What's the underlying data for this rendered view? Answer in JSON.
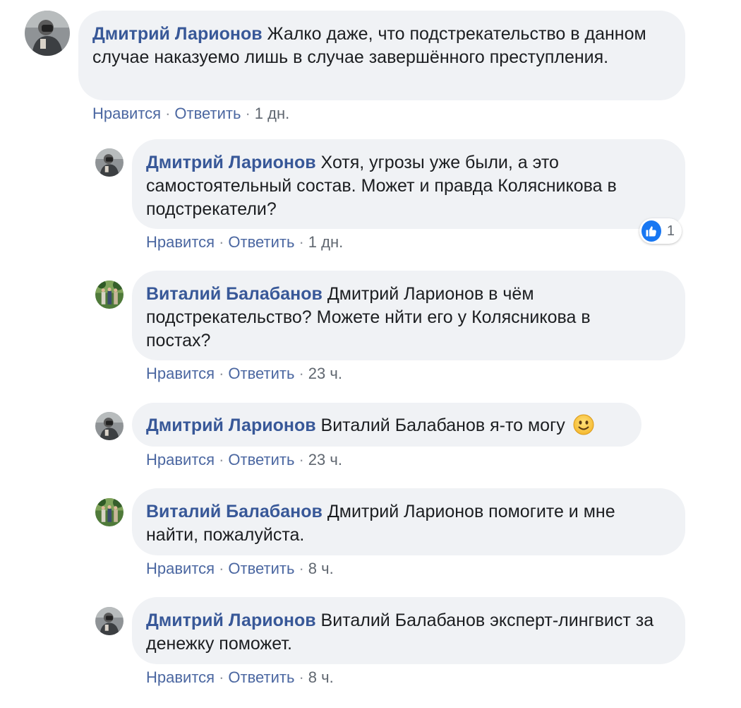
{
  "comments": [
    {
      "author": "Дмитрий Ларионов",
      "text": "Жалко даже, что подстрекательство в данном случае наказуемо лишь в случае завершённого преступления.",
      "like_label": "Нравится",
      "reply_label": "Ответить",
      "time": "1 дн."
    },
    {
      "author": "Дмитрий Ларионов",
      "text": "Хотя, угрозы уже были, а это самостоятельный состав. Может и правда Колясникова в подстрекатели?",
      "like_label": "Нравится",
      "reply_label": "Ответить",
      "time": "1 дн.",
      "reaction_count": "1",
      "reaction_icon": "like-icon"
    },
    {
      "author": "Виталий Балабанов",
      "text": "Дмитрий Ларионов в чём подстрекательство? Можете нйти его у Колясникова в постах?",
      "like_label": "Нравится",
      "reply_label": "Ответить",
      "time": "23 ч."
    },
    {
      "author": "Дмитрий Ларионов",
      "text": "Виталий Балабанов я-то могу",
      "emoji": "slightly-smiling-face-icon",
      "like_label": "Нравится",
      "reply_label": "Ответить",
      "time": "23 ч."
    },
    {
      "author": "Виталий Балабанов",
      "text": "Дмитрий Ларионов помогите и мне найти, пожалуйста.",
      "like_label": "Нравится",
      "reply_label": "Ответить",
      "time": "8 ч."
    },
    {
      "author": "Дмитрий Ларионов",
      "text": "Виталий Балабанов эксперт-лингвист за денежку поможет.",
      "like_label": "Нравится",
      "reply_label": "Ответить",
      "time": "8 ч."
    }
  ],
  "colors": {
    "bubble": "#f0f2f5",
    "author": "#385898",
    "link": "#4b67a1",
    "meta": "#606770",
    "like_badge": "#1877f2"
  }
}
